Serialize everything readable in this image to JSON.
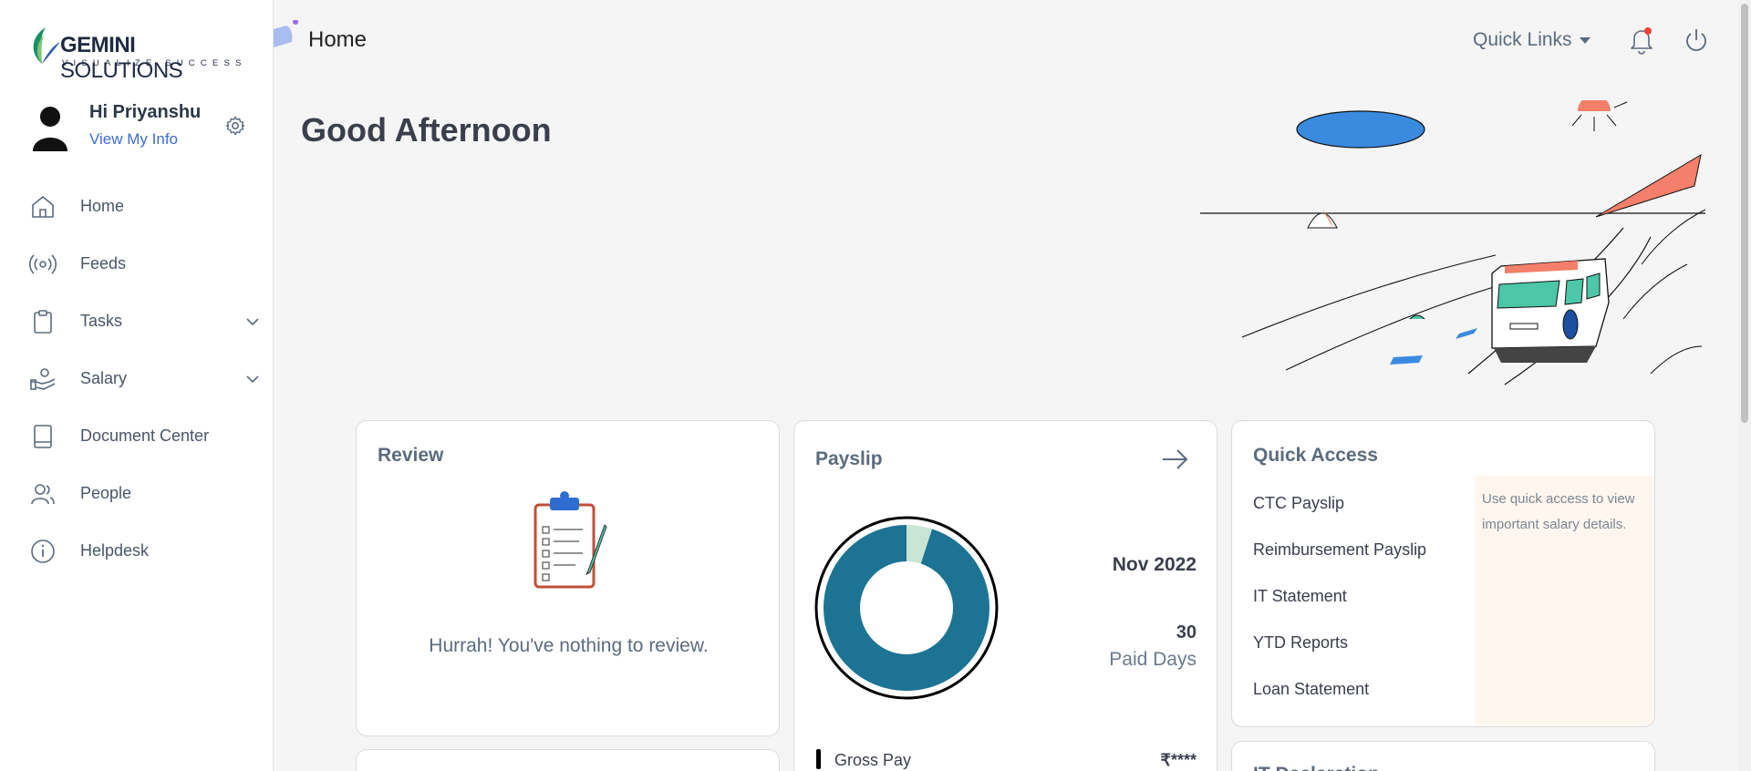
{
  "logo": {
    "brand_bold": "GEMINI",
    "brand_light": " SOLUTIONS",
    "tagline": "VISUALIZE SUCCESS"
  },
  "profile": {
    "greeting": "Hi Priyanshu",
    "view_info": "View My Info"
  },
  "nav": {
    "items": [
      {
        "label": "Home",
        "icon": "home-icon"
      },
      {
        "label": "Feeds",
        "icon": "broadcast-icon"
      },
      {
        "label": "Tasks",
        "icon": "clipboard-icon"
      },
      {
        "label": "Salary",
        "icon": "hand-coin-icon"
      },
      {
        "label": "Document Center",
        "icon": "book-icon"
      },
      {
        "label": "People",
        "icon": "people-icon"
      },
      {
        "label": "Helpdesk",
        "icon": "info-icon"
      }
    ]
  },
  "topbar": {
    "title": "Home",
    "quick_links": "Quick Links"
  },
  "main": {
    "greeting": "Good Afternoon"
  },
  "review": {
    "title": "Review",
    "message": "Hurrah! You've nothing to review."
  },
  "payslip": {
    "title": "Payslip",
    "month": "Nov 2022",
    "paid_days": "30",
    "paid_days_label": "Paid Days",
    "gross_label": "Gross Pay",
    "gross_value": "₹****",
    "donut": {
      "main_fraction": 0.95,
      "main_color": "#1d7394",
      "secondary_color": "#c9e5d3"
    }
  },
  "quick_access": {
    "title": "Quick Access",
    "items": [
      "CTC Payslip",
      "Reimbursement Payslip",
      "IT Statement",
      "YTD Reports",
      "Loan Statement"
    ],
    "hint": "Use quick access to view important salary details."
  },
  "it_declaration": {
    "title": "IT Declaration"
  },
  "colors": {
    "accent": "#3f6bd6",
    "sidebar_bg": "#ffffff",
    "page_bg": "#f5f5f5"
  }
}
